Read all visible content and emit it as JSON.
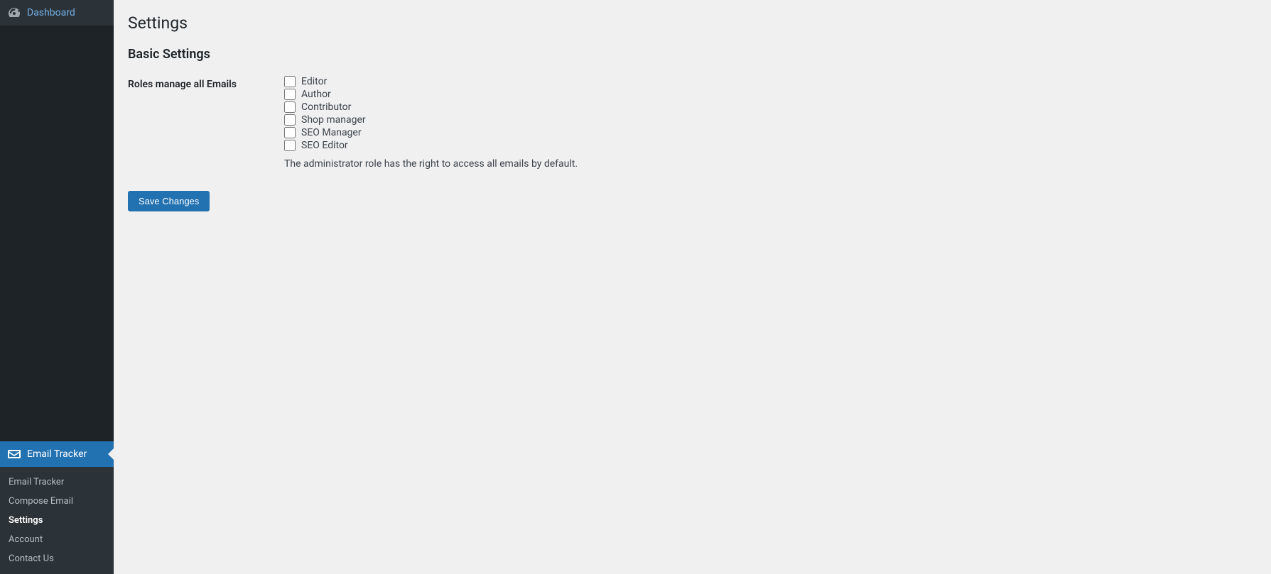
{
  "sidebar": {
    "dashboard": "Dashboard",
    "email_tracker": "Email Tracker",
    "submenu": {
      "email_tracker": "Email Tracker",
      "compose_email": "Compose Email",
      "settings": "Settings",
      "account": "Account",
      "contact_us": "Contact Us"
    }
  },
  "main": {
    "page_title": "Settings",
    "section_title": "Basic Settings",
    "roles_label": "Roles manage all Emails",
    "roles": {
      "editor": "Editor",
      "author": "Author",
      "contributor": "Contributor",
      "shop_manager": "Shop manager",
      "seo_manager": "SEO Manager",
      "seo_editor": "SEO Editor"
    },
    "description": "The administrator role has the right to access all emails by default.",
    "save_button": "Save Changes"
  }
}
